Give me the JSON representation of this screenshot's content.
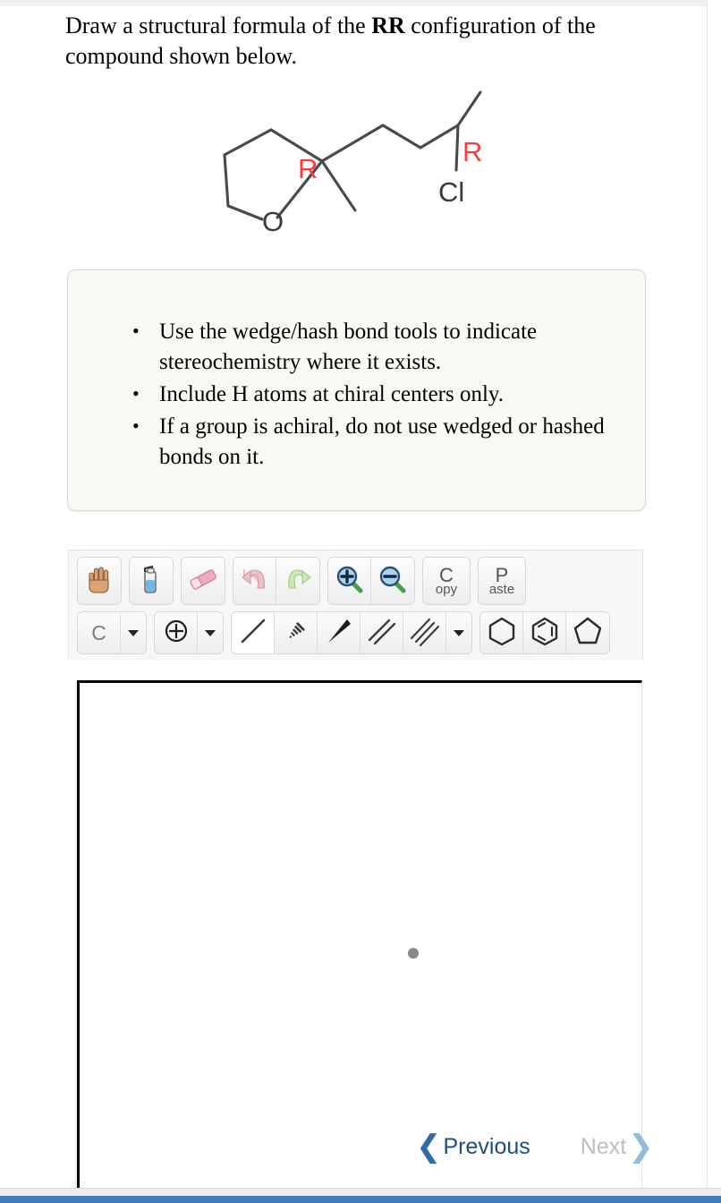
{
  "prompt": {
    "text_before": "Draw a structural formula of the ",
    "emphasis": "RR",
    "text_after": " configuration of the compound shown below."
  },
  "structure": {
    "name": "2-(3-chlorobutyl)-2-methyloxolane",
    "labels": {
      "ring_stereo": "R",
      "chain_stereo": "R",
      "oxygen": "O",
      "chlorine": "Cl"
    },
    "colors": {
      "stereo_label": "#f83c3c",
      "atom_label": "#3a3a3a",
      "bond": "#4a4a4a"
    }
  },
  "instructions": {
    "items": [
      "Use the wedge/hash bond tools to indicate stereochemistry where it exists.",
      "Include H atoms at chiral centers only.",
      "If a group is achiral, do not use wedged or hashed bonds on it."
    ]
  },
  "editor": {
    "toolbar_row1": [
      {
        "name": "pan-tool",
        "icon": "hand-icon"
      },
      {
        "name": "clean-tool",
        "icon": "spray-bottle-icon"
      },
      {
        "name": "eraser-tool",
        "icon": "eraser-icon"
      },
      {
        "name": "undo-tool",
        "icon": "undo-arrow-icon"
      },
      {
        "name": "redo-tool",
        "icon": "redo-arrow-icon"
      },
      {
        "name": "zoom-in-tool",
        "icon": "magnifier-plus-icon"
      },
      {
        "name": "zoom-out-tool",
        "icon": "magnifier-minus-icon"
      },
      {
        "name": "copy-tool",
        "icon": "copy-text-icon",
        "big": "C",
        "small": "opy"
      },
      {
        "name": "paste-tool",
        "icon": "paste-text-icon",
        "big": "P",
        "small": "aste"
      }
    ],
    "toolbar_row2": {
      "element_button": "C",
      "charge_icon": "circle-plus-icon",
      "bonds": [
        {
          "name": "single-bond-tool",
          "icon": "single-bond-icon",
          "selected": true
        },
        {
          "name": "hash-bond-tool",
          "icon": "hash-bond-icon",
          "selected": false
        },
        {
          "name": "wedge-bond-tool",
          "icon": "wedge-bond-icon",
          "selected": false
        },
        {
          "name": "double-bond-tool",
          "icon": "double-bond-icon",
          "selected": false
        },
        {
          "name": "triple-bond-tool",
          "icon": "triple-bond-icon",
          "selected": false
        }
      ],
      "templates": [
        {
          "name": "cyclohexane-template",
          "icon": "hexagon-icon"
        },
        {
          "name": "benzene-template",
          "icon": "benzene-ring-icon"
        },
        {
          "name": "cyclopentane-template",
          "icon": "pentagon-icon"
        }
      ]
    },
    "canvas": {
      "center_marker": "atom-placement-dot"
    }
  },
  "navigation": {
    "previous_label": "Previous",
    "next_label": "Next",
    "previous_enabled": true,
    "next_enabled": false,
    "previous_color": "#1f4e79",
    "next_color": "#b9bfc4"
  }
}
